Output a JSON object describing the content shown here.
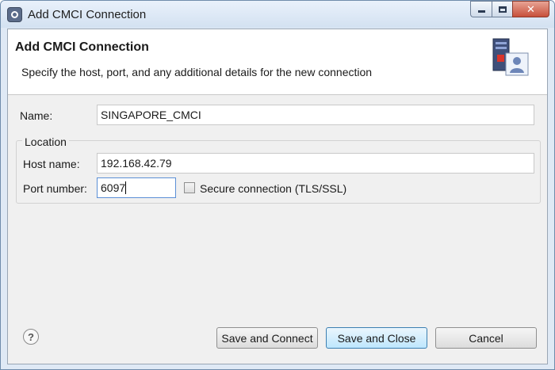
{
  "window": {
    "title": "Add CMCI Connection",
    "minimize_symbol": "",
    "maximize_symbol": "",
    "close_symbol": "✕"
  },
  "header": {
    "title": "Add CMCI Connection",
    "description": "Specify the host, port, and any additional details for the new connection",
    "image_icon": "server-user-icon"
  },
  "form": {
    "name_label": "Name:",
    "name_value": "SINGAPORE_CMCI",
    "location_group_label": "Location",
    "host_label": "Host name:",
    "host_value": "192.168.42.79",
    "port_label": "Port number:",
    "port_value": "6097",
    "secure_label": "Secure connection (TLS/SSL)",
    "secure_checked": false
  },
  "footer": {
    "help_symbol": "?",
    "save_connect_label": "Save and Connect",
    "save_close_label": "Save and Close",
    "cancel_label": "Cancel"
  },
  "colors": {
    "accent": "#3c7fb1",
    "focus_border": "#5b8fd6",
    "close_button": "#c7503b"
  }
}
